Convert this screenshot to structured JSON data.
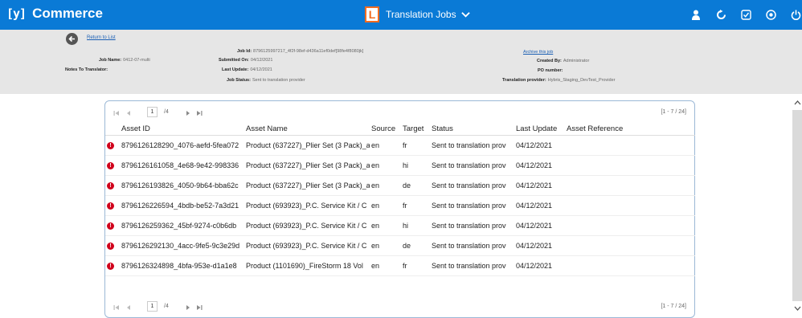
{
  "app": {
    "logo": "[y]",
    "name": "Commerce",
    "nav_badge": "L",
    "nav_label": "Translation Jobs",
    "top_icons": [
      "user-icon",
      "refresh-icon",
      "checklist-icon",
      "globe-icon",
      "power-icon"
    ]
  },
  "header": {
    "return_link": "Return to List",
    "job_id_label": "Job Id:",
    "job_id_value": "8796125997217_4f2f-98ef-d436a11ef0def[98fe4f8080jk]",
    "job_name_label": "Job Name:",
    "job_name_value": "0412-07-multi",
    "submitted_label": "Submitted On:",
    "submitted_value": "04/12/2021",
    "notes_label": "Notes To Translator:",
    "last_update_label": "Last Update:",
    "last_update_value": "04/12/2021",
    "job_status_label": "Job Status:",
    "job_status_value": "Sent to translation provider",
    "archive_link": "Archive this job",
    "created_by_label": "Created By:",
    "created_by_value": "Administrator",
    "po_label": "PO number:",
    "provider_label": "Translation provider:",
    "provider_value": "Hybris_Staging_DevTest_Provider"
  },
  "pager": {
    "page": "1",
    "total": "/4",
    "range": "[1 - 7 / 24]"
  },
  "table": {
    "columns": [
      "Asset ID",
      "Asset Name",
      "Source",
      "Target",
      "Status",
      "Last Update",
      "Asset Reference"
    ],
    "rows": [
      {
        "id": "8796126128290_4076-aefd-5fea072",
        "name": "Product (637227)_Plier Set (3 Pack)_a",
        "source": "en",
        "target": "fr",
        "status": "Sent to translation prov",
        "updated": "04/12/2021",
        "ref": ""
      },
      {
        "id": "8796126161058_4e68-9e42-998336",
        "name": "Product (637227)_Plier Set (3 Pack)_a",
        "source": "en",
        "target": "hi",
        "status": "Sent to translation prov",
        "updated": "04/12/2021",
        "ref": ""
      },
      {
        "id": "8796126193826_4050-9b64-bba62c",
        "name": "Product (637227)_Plier Set (3 Pack)_a",
        "source": "en",
        "target": "de",
        "status": "Sent to translation prov",
        "updated": "04/12/2021",
        "ref": ""
      },
      {
        "id": "8796126226594_4bdb-be52-7a3d21",
        "name": "Product (693923)_P.C. Service Kit / C",
        "source": "en",
        "target": "fr",
        "status": "Sent to translation prov",
        "updated": "04/12/2021",
        "ref": ""
      },
      {
        "id": "8796126259362_45bf-9274-c0b6db",
        "name": "Product (693923)_P.C. Service Kit / C",
        "source": "en",
        "target": "hi",
        "status": "Sent to translation prov",
        "updated": "04/12/2021",
        "ref": ""
      },
      {
        "id": "8796126292130_4acc-9fe5-9c3e29d",
        "name": "Product (693923)_P.C. Service Kit / C",
        "source": "en",
        "target": "de",
        "status": "Sent to translation prov",
        "updated": "04/12/2021",
        "ref": ""
      },
      {
        "id": "8796126324898_4bfa-953e-d1a1e8",
        "name": "Product (1101690)_FireStorm 18 Vol",
        "source": "en",
        "target": "fr",
        "status": "Sent to translation prov",
        "updated": "04/12/2021",
        "ref": ""
      }
    ]
  },
  "colors": {
    "topbar": "#0a7ad6",
    "badge_accent": "#f36c21",
    "error": "#d0021b",
    "link": "#1a5fb4"
  }
}
